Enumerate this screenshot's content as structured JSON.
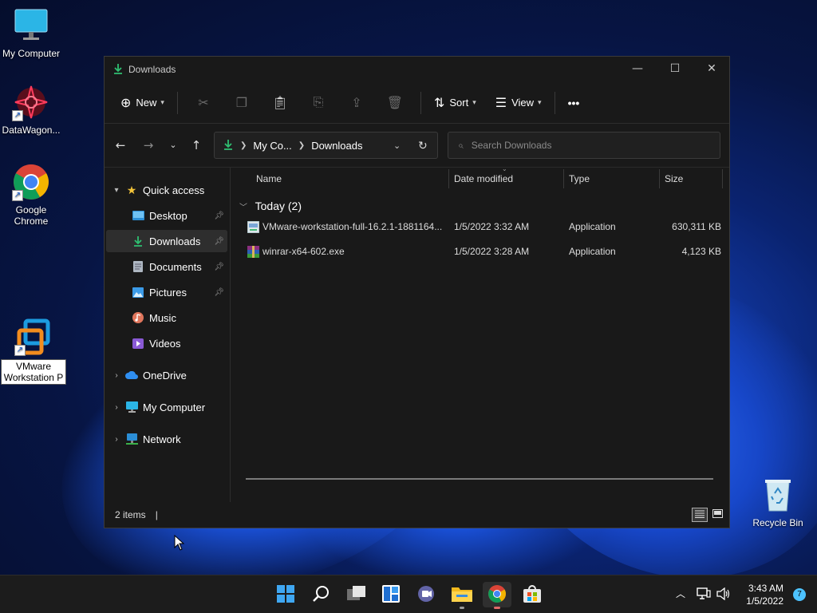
{
  "desktop": {
    "icons": [
      {
        "label": "My Computer",
        "icon": "monitor-icon"
      },
      {
        "label": "DataWagon...",
        "icon": "datawagon-icon"
      },
      {
        "label": "Google Chrome",
        "icon": "chrome-icon"
      },
      {
        "label": "VMware Workstation P",
        "icon": "vmware-icon"
      },
      {
        "label": "Recycle Bin",
        "icon": "recycle-bin-icon"
      }
    ]
  },
  "window": {
    "title": "Downloads",
    "controls": {
      "minimize": "—",
      "maximize": "☐",
      "close": "✕"
    },
    "command_bar": {
      "new_label": "New",
      "sort_label": "Sort",
      "view_label": "View",
      "more_label": "•••"
    },
    "address": {
      "segments": [
        "My Co...",
        "Downloads"
      ]
    },
    "search": {
      "placeholder": "Search Downloads"
    },
    "nav": {
      "quick_access": "Quick access",
      "items": [
        {
          "label": "Desktop",
          "icon": "desktop-folder-icon",
          "pinned": true
        },
        {
          "label": "Downloads",
          "icon": "downloads-folder-icon",
          "pinned": true,
          "selected": true
        },
        {
          "label": "Documents",
          "icon": "documents-folder-icon",
          "pinned": true
        },
        {
          "label": "Pictures",
          "icon": "pictures-folder-icon",
          "pinned": true
        },
        {
          "label": "Music",
          "icon": "music-folder-icon",
          "pinned": false
        },
        {
          "label": "Videos",
          "icon": "videos-folder-icon",
          "pinned": false
        }
      ],
      "onedrive": "OneDrive",
      "my_computer": "My Computer",
      "network": "Network"
    },
    "columns": [
      "Name",
      "Date modified",
      "Type",
      "Size"
    ],
    "group_label": "Today (2)",
    "files": [
      {
        "name": "VMware-workstation-full-16.2.1-1881164...",
        "date": "1/5/2022 3:32 AM",
        "type": "Application",
        "size": "630,311 KB",
        "icon": "installer-icon"
      },
      {
        "name": "winrar-x64-602.exe",
        "date": "1/5/2022 3:28 AM",
        "type": "Application",
        "size": "4,123 KB",
        "icon": "winrar-icon"
      }
    ],
    "status": {
      "items_count": "2 items",
      "separator": "|"
    }
  },
  "taskbar": {
    "apps": [
      "start-icon",
      "search-icon",
      "task-view-icon",
      "widgets-icon",
      "teams-chat-icon",
      "file-explorer-icon",
      "chrome-icon",
      "store-icon"
    ],
    "time": "3:43 AM",
    "date": "1/5/2022",
    "notification_count": "7"
  },
  "colors": {
    "accent_green": "#2fbf71",
    "window_bg": "#191919",
    "taskbar_bg": "#1c1c1c",
    "notif_badge": "#4cc2ff"
  }
}
